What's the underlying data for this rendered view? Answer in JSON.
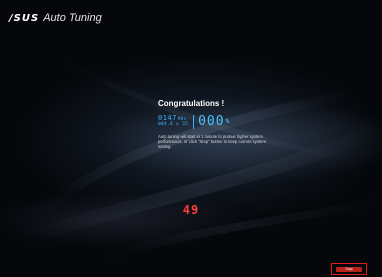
{
  "header": {
    "logo_text": "/SUS",
    "app_title": "Auto Tuning"
  },
  "result": {
    "heading": "Congratulations !",
    "cpu_frequency": "0147",
    "cpu_frequency_unit": "MHz",
    "multiplier_text": "004.8 x 35",
    "percent_value": "000",
    "percent_sign": "%",
    "description": "Auto tuning will start in 1 minute to pursue higher system performance, or click \"Stop\" button to keep current system setting."
  },
  "countdown": {
    "value": "49"
  },
  "footer": {
    "stop_label": "Stop"
  },
  "colors": {
    "accent_blue": "#37b6ff",
    "countdown_red": "#ff3c3c",
    "stop_red": "#b8211c"
  }
}
